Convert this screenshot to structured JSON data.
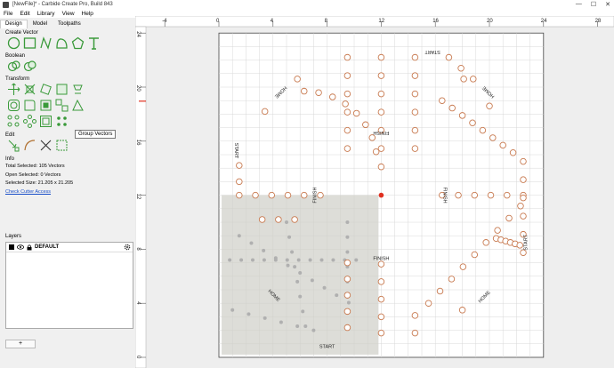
{
  "window": {
    "title": "[NewFile]* - Carbide Create Pro, Build 843",
    "controls": [
      "—",
      "☐",
      "✕"
    ]
  },
  "menu": [
    "File",
    "Edit",
    "Library",
    "View",
    "Help"
  ],
  "tabs": [
    {
      "label": "Design",
      "active": true
    },
    {
      "label": "Model",
      "active": false
    },
    {
      "label": "Toolpaths",
      "active": false
    }
  ],
  "sections": {
    "create_vector": "Create Vector",
    "boolean": "Boolean",
    "transform": "Transform",
    "edit": "Edit",
    "info": "Info",
    "layers": "Layers"
  },
  "tooltip": "Group Vectors",
  "info": {
    "total_selected": "Total Selected:   105 Vectors",
    "open_selected": "Open Selected:   0 Vectors",
    "selected_size": "Selected Size:    21.205 x 21.205",
    "link": "Check Cutter Access"
  },
  "layers": [
    {
      "name": "DEFAULT",
      "color": "#000000"
    }
  ],
  "add_layer_label": "+",
  "ruler": {
    "top_labels": [
      "-4",
      "0",
      "4",
      "8",
      "12",
      "16",
      "20",
      "24",
      "28"
    ],
    "left_labels": [
      "24",
      "20",
      "16",
      "12",
      "8",
      "4",
      "0"
    ]
  },
  "board_labels": {
    "start": "START",
    "home": "HOME",
    "finish": "FINISH"
  },
  "colors": {
    "hole": "#c87a50",
    "selection": "#b0b0b0",
    "grid": "#d8d8d8",
    "accent": "#e03020"
  }
}
